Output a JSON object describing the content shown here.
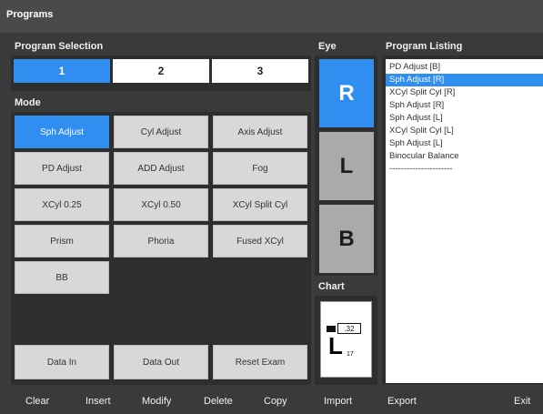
{
  "window": {
    "title": "Programs"
  },
  "program_selection": {
    "header": "Program Selection",
    "tabs": [
      "1",
      "2",
      "3"
    ],
    "active_tab": "1"
  },
  "mode": {
    "header": "Mode",
    "buttons": [
      "Sph Adjust",
      "Cyl Adjust",
      "Axis Adjust",
      "PD Adjust",
      "ADD Adjust",
      "Fog",
      "XCyl 0.25",
      "XCyl 0.50",
      "XCyl Split Cyl",
      "Prism",
      "Phoria",
      "Fused XCyl",
      "BB"
    ],
    "active": "Sph Adjust",
    "footer_buttons": [
      "Data In",
      "Data Out",
      "Reset Exam"
    ]
  },
  "eye": {
    "header": "Eye",
    "buttons": [
      "R",
      "L",
      "B"
    ],
    "active": "R"
  },
  "chart": {
    "header": "Chart",
    "box_label": ".32",
    "letter": "L",
    "letter_sub": "17"
  },
  "program_listing": {
    "header": "Program Listing",
    "items": [
      "PD Adjust [B]",
      "Sph Adjust [R]",
      "XCyl Split Cyl [R]",
      "Sph Adjust [R]",
      "Sph Adjust [L]",
      "XCyl Split Cyl [L]",
      "Sph Adjust [L]",
      "Binocular Balance",
      "----------------------"
    ],
    "selected_index": 1
  },
  "footer": {
    "buttons": [
      "Clear",
      "Insert",
      "Modify",
      "Delete",
      "Copy",
      "Import",
      "Export",
      "Exit"
    ]
  },
  "colors": {
    "accent": "#2f8ef0",
    "button": "#d8d8d8",
    "background": "#3b3b3b"
  }
}
